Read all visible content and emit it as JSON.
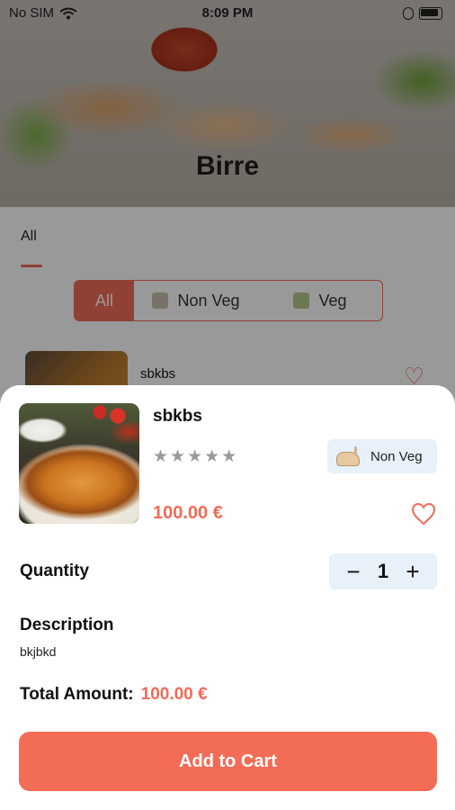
{
  "status_bar": {
    "carrier": "No SIM",
    "time": "8:09 PM"
  },
  "hero": {
    "title": "Birre"
  },
  "tabs": [
    {
      "label": "All"
    }
  ],
  "filter": {
    "all": "All",
    "non_veg": "Non Veg",
    "veg": "Veg"
  },
  "list_item": {
    "name": "sbkbs"
  },
  "product": {
    "name": "sbkbs",
    "rating": 0,
    "rating_max": 5,
    "star_glyph": "★",
    "type_label": "Non Veg",
    "price": "100.00 €"
  },
  "quantity": {
    "label": "Quantity",
    "value": "1",
    "minus": "−",
    "plus": "+"
  },
  "description": {
    "title": "Description",
    "text": "bkjbkd"
  },
  "total": {
    "label": "Total Amount:",
    "value": "100.00 €"
  },
  "cart_button": {
    "label": "Add to Cart"
  },
  "colors": {
    "accent": "#f26b57",
    "chip_bg": "#e8f0fa"
  }
}
